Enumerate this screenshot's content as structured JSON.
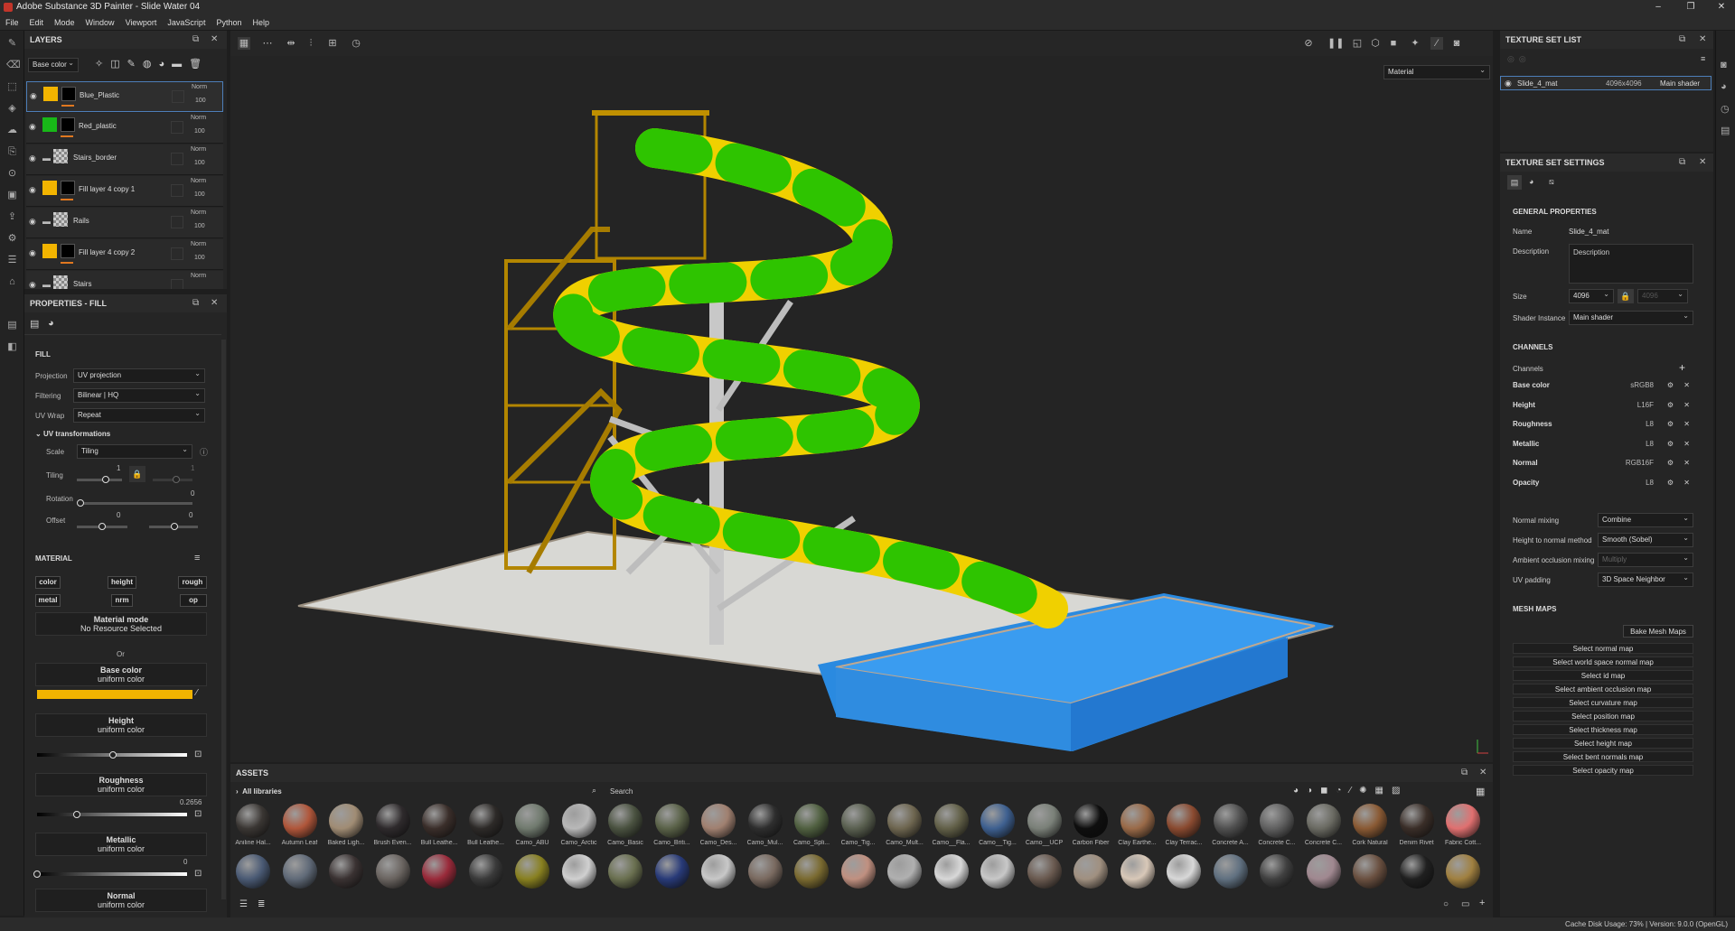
{
  "titlebar": {
    "title": "Adobe Substance 3D Painter - Slide Water 04",
    "min": "–",
    "max": "❐",
    "close": "✕"
  },
  "menu": [
    "File",
    "Edit",
    "Mode",
    "Window",
    "Viewport",
    "JavaScript",
    "Python",
    "Help"
  ],
  "layers": {
    "title": "LAYERS",
    "channel_select": "Base color",
    "rows": [
      {
        "name": "Blue_Plastic",
        "blend": "Norm",
        "opacity": "100",
        "color": "#f2b400",
        "active": true
      },
      {
        "name": "Red_plastic",
        "blend": "Norm",
        "opacity": "100",
        "color": "#18b818",
        "active": false
      },
      {
        "name": "Stairs_border",
        "blend": "Norm",
        "opacity": "100",
        "color": "folder",
        "active": false
      },
      {
        "name": "Fill layer 4 copy 1",
        "blend": "Norm",
        "opacity": "100",
        "color": "#f2b400",
        "active": false
      },
      {
        "name": "Rails",
        "blend": "Norm",
        "opacity": "100",
        "color": "folder",
        "active": false
      },
      {
        "name": "Fill layer 4 copy 2",
        "blend": "Norm",
        "opacity": "100",
        "color": "#f2b400",
        "active": false
      },
      {
        "name": "Stairs",
        "blend": "Norm",
        "opacity": "",
        "color": "folder",
        "active": false
      }
    ]
  },
  "properties": {
    "title": "PROPERTIES - FILL",
    "fill_label": "FILL",
    "projection_label": "Projection",
    "projection": "UV projection",
    "filtering_label": "Filtering",
    "filtering": "Bilinear | HQ",
    "uvwrap_label": "UV Wrap",
    "uvwrap": "Repeat",
    "uvt_label": "UV transformations",
    "scale_label": "Scale",
    "scale": "Tiling",
    "tiling_label": "Tiling",
    "tiling_a": "1",
    "tiling_b": "1",
    "rotation_label": "Rotation",
    "rotation": "0",
    "offset_label": "Offset",
    "offset_a": "0",
    "offset_b": "0",
    "material_label": "MATERIAL",
    "chips": [
      "color",
      "height",
      "rough",
      "metal",
      "nrm",
      "op"
    ],
    "material_mode": "Material mode",
    "no_resource": "No Resource Selected",
    "or": "Or",
    "base_color": "Base color",
    "uniform": "uniform color",
    "height": "Height",
    "roughness": "Roughness",
    "roughness_value": "0.2656",
    "roughness_level": 0.2656,
    "metallic": "Metallic",
    "metallic_value": "0",
    "normal": "Normal",
    "accent": "#f2b400"
  },
  "viewport": {
    "mode": "Material"
  },
  "assets": {
    "title": "ASSETS",
    "libraries": "All libraries",
    "search": "Search",
    "items": [
      {
        "name": "Aniline Hal...",
        "c": "#3a3633"
      },
      {
        "name": "Autumn Leaf",
        "c": "#b0563a"
      },
      {
        "name": "Baked Ligh...",
        "c": "#a08c74"
      },
      {
        "name": "Brush Even...",
        "c": "#2e2a2c"
      },
      {
        "name": "Bull Leathe...",
        "c": "#3a2e2a"
      },
      {
        "name": "Bull Leathe...",
        "c": "#2d2a28"
      },
      {
        "name": "Camo_ABU",
        "c": "#707a6e"
      },
      {
        "name": "Camo_Arctic",
        "c": "#b8b8b8"
      },
      {
        "name": "Camo_Basic",
        "c": "#4a5240"
      },
      {
        "name": "Camo_Briti...",
        "c": "#5a6248"
      },
      {
        "name": "Camo_Des...",
        "c": "#a08070"
      },
      {
        "name": "Camo_Mul...",
        "c": "#2e2e2e"
      },
      {
        "name": "Camo_Spli...",
        "c": "#506040"
      },
      {
        "name": "Camo_Tig...",
        "c": "#5a6050"
      },
      {
        "name": "Camo_Mult...",
        "c": "#6e6650"
      },
      {
        "name": "Camo__Fla...",
        "c": "#626048"
      },
      {
        "name": "Camo__Tig...",
        "c": "#3e6090"
      },
      {
        "name": "Camo__UCP",
        "c": "#7a8078"
      },
      {
        "name": "Carbon Fiber",
        "c": "#0e0e0e"
      },
      {
        "name": "Clay Earthe...",
        "c": "#9a6a48"
      },
      {
        "name": "Clay Terrac...",
        "c": "#8a4a30"
      },
      {
        "name": "Concrete A...",
        "c": "#505050"
      },
      {
        "name": "Concrete C...",
        "c": "#606060"
      },
      {
        "name": "Concrete C...",
        "c": "#6a6a62"
      },
      {
        "name": "Cork Natural",
        "c": "#8a5a34"
      },
      {
        "name": "Denim Rivet",
        "c": "#3a2e28"
      },
      {
        "name": "Fabric Cott...",
        "c": "#e07070"
      }
    ],
    "row2": [
      "#4a5a74",
      "#606a78",
      "#3a3232",
      "#6a6460",
      "#9a2a3a",
      "#3a3a3a",
      "#888020",
      "#d0d0d0",
      "#6a7050",
      "#283a78",
      "#c8c8c8",
      "#7a6a60",
      "#7a6a30",
      "#c09080",
      "#b0b0b0",
      "#d8d8d8",
      "#c8c8c8",
      "#6a5a50",
      "#a09080",
      "#d8c8b8",
      "#d8d8d8",
      "#607080",
      "#404040",
      "#a08890",
      "#6a5040",
      "#202020",
      "#a08040"
    ]
  },
  "texture_set_list": {
    "title": "TEXTURE SET LIST",
    "name": "Slide_4_mat",
    "size": "4096x4096",
    "shader": "Main shader"
  },
  "texture_set_settings": {
    "title": "TEXTURE SET SETTINGS",
    "general": "GENERAL PROPERTIES",
    "name_label": "Name",
    "name": "Slide_4_mat",
    "desc_label": "Description",
    "desc": "Description",
    "size_label": "Size",
    "size": "4096",
    "size2": "4096",
    "shader_label": "Shader Instance",
    "shader": "Main shader",
    "channels_title": "CHANNELS",
    "channels_label": "Channels",
    "channels": [
      {
        "name": "Base color",
        "format": "sRGB8"
      },
      {
        "name": "Height",
        "format": "L16F"
      },
      {
        "name": "Roughness",
        "format": "L8"
      },
      {
        "name": "Metallic",
        "format": "L8"
      },
      {
        "name": "Normal",
        "format": "RGB16F"
      },
      {
        "name": "Opacity",
        "format": "L8"
      }
    ],
    "normal_mixing_label": "Normal mixing",
    "normal_mixing": "Combine",
    "h2n_label": "Height to normal method",
    "h2n": "Smooth (Sobel)",
    "aom_label": "Ambient occlusion mixing",
    "aom": "Multiply",
    "uvpad_label": "UV padding",
    "uvpad": "3D Space Neighbor",
    "mesh_maps": "MESH MAPS",
    "bake": "Bake Mesh Maps",
    "maps": [
      "Select normal map",
      "Select world space normal map",
      "Select id map",
      "Select ambient occlusion map",
      "Select curvature map",
      "Select position map",
      "Select thickness map",
      "Select height map",
      "Select bent normals map",
      "Select opacity map"
    ]
  },
  "status": "Cache Disk Usage:   73% | Version: 9.0.0 (OpenGL)"
}
